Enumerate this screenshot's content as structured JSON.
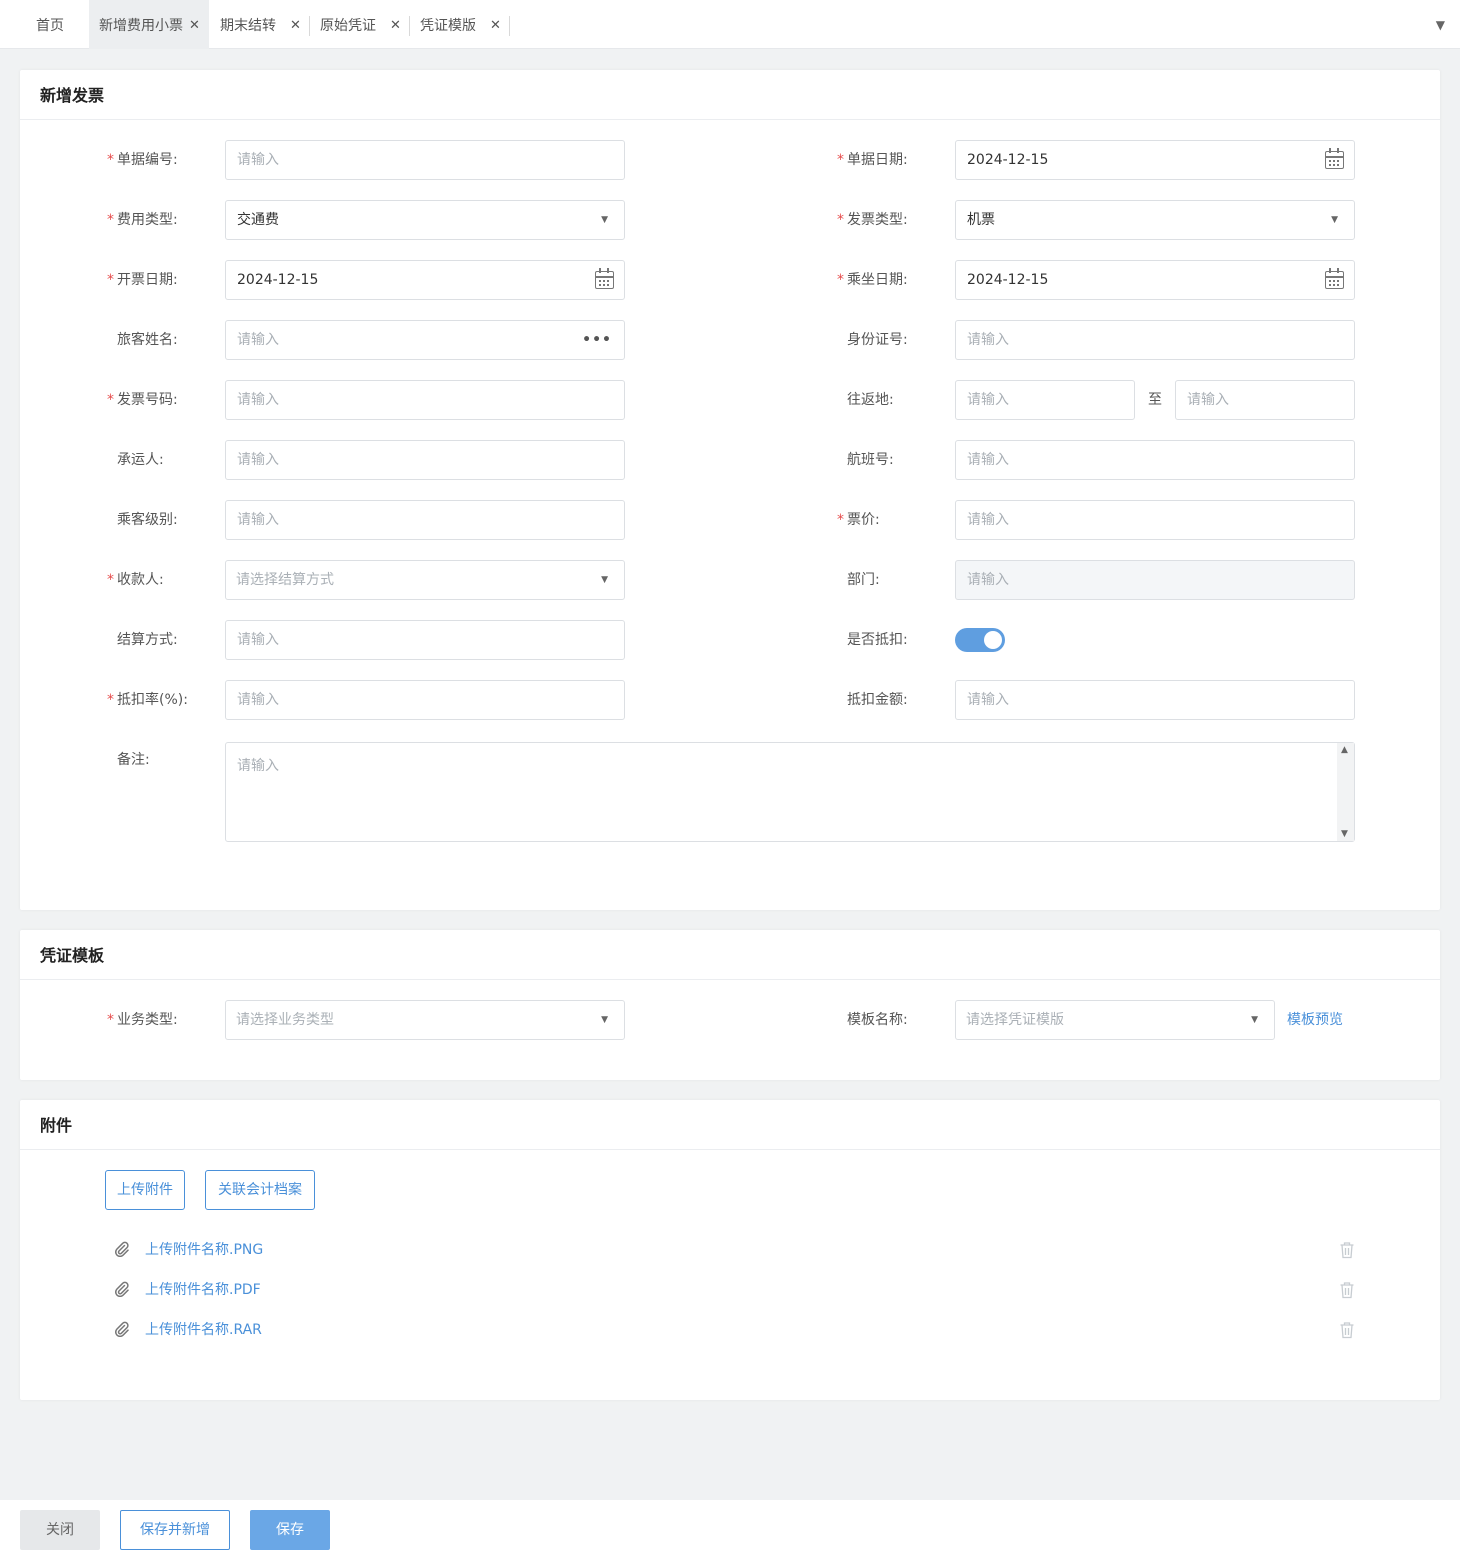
{
  "tabs": [
    {
      "label": "首页",
      "closable": false,
      "active": false
    },
    {
      "label": "新增费用小票",
      "closable": true,
      "active": true
    },
    {
      "label": "期末结转",
      "closable": true,
      "active": false
    },
    {
      "label": "原始凭证",
      "closable": true,
      "active": false
    },
    {
      "label": "凭证模版",
      "closable": true,
      "active": false
    }
  ],
  "tab_close_glyph": "✕",
  "tab_menu_glyph": "▼",
  "invoice": {
    "title": "新增发票",
    "fields": {
      "doc_no": {
        "label": "单据编号:",
        "required": true,
        "placeholder": "请输入",
        "value": ""
      },
      "doc_date": {
        "label": "单据日期:",
        "required": true,
        "value": "2024-12-15"
      },
      "expense_type": {
        "label": "费用类型:",
        "required": true,
        "value": "交通费"
      },
      "invoice_type": {
        "label": "发票类型:",
        "required": true,
        "value": "机票"
      },
      "issue_date": {
        "label": "开票日期:",
        "required": true,
        "value": "2024-12-15"
      },
      "ride_date": {
        "label": "乘坐日期:",
        "required": true,
        "value": "2024-12-15"
      },
      "passenger": {
        "label": "旅客姓名:",
        "required": false,
        "placeholder": "请输入"
      },
      "id_no": {
        "label": "身份证号:",
        "required": false,
        "placeholder": "请输入"
      },
      "invoice_no": {
        "label": "发票号码:",
        "required": true,
        "placeholder": "请输入"
      },
      "route": {
        "label": "往返地:",
        "required": false,
        "from_placeholder": "请输入",
        "to_placeholder": "请输入",
        "separator": "至"
      },
      "carrier": {
        "label": "承运人:",
        "required": false,
        "placeholder": "请输入"
      },
      "flight_no": {
        "label": "航班号:",
        "required": false,
        "placeholder": "请输入"
      },
      "cabin_class": {
        "label": "乘客级别:",
        "required": false,
        "placeholder": "请输入"
      },
      "price": {
        "label": "票价:",
        "required": true,
        "placeholder": "请输入"
      },
      "payee": {
        "label": "收款人:",
        "required": true,
        "placeholder": "请选择结算方式"
      },
      "department": {
        "label": "部门:",
        "required": false,
        "placeholder": "请输入",
        "disabled": true
      },
      "settlement": {
        "label": "结算方式:",
        "required": false,
        "placeholder": "请输入"
      },
      "deductible": {
        "label": "是否抵扣:",
        "required": false,
        "on": true
      },
      "deduct_rate": {
        "label": "抵扣率(%):",
        "required": true,
        "placeholder": "请输入"
      },
      "deduct_amount": {
        "label": "抵扣金额:",
        "required": false,
        "placeholder": "请输入"
      },
      "remark": {
        "label": "备注:",
        "required": false,
        "placeholder": "请输入"
      }
    }
  },
  "voucher": {
    "title": "凭证模板",
    "business_type": {
      "label": "业务类型:",
      "required": true,
      "placeholder": "请选择业务类型"
    },
    "template_name": {
      "label": "模板名称:",
      "required": false,
      "placeholder": "请选择凭证模版"
    },
    "preview_link": "模板预览"
  },
  "attachments": {
    "title": "附件",
    "upload_button": "上传附件",
    "link_archive_button": "关联会计档案",
    "files": [
      "上传附件名称.PNG",
      "上传附件名称.PDF",
      "上传附件名称.RAR"
    ]
  },
  "footer": {
    "close": "关闭",
    "save_and_new": "保存并新增",
    "save": "保存"
  },
  "colors": {
    "accent": "#4a90d9",
    "primary_button": "#6aa7e6",
    "required": "#e64c4c",
    "toggle_on": "#5f9ee0"
  },
  "icons": {
    "calendar": "calendar-icon",
    "ellipsis": "more-icon",
    "dropdown": "chevron-down-icon",
    "attachment": "paperclip-icon",
    "delete": "trash-icon"
  }
}
